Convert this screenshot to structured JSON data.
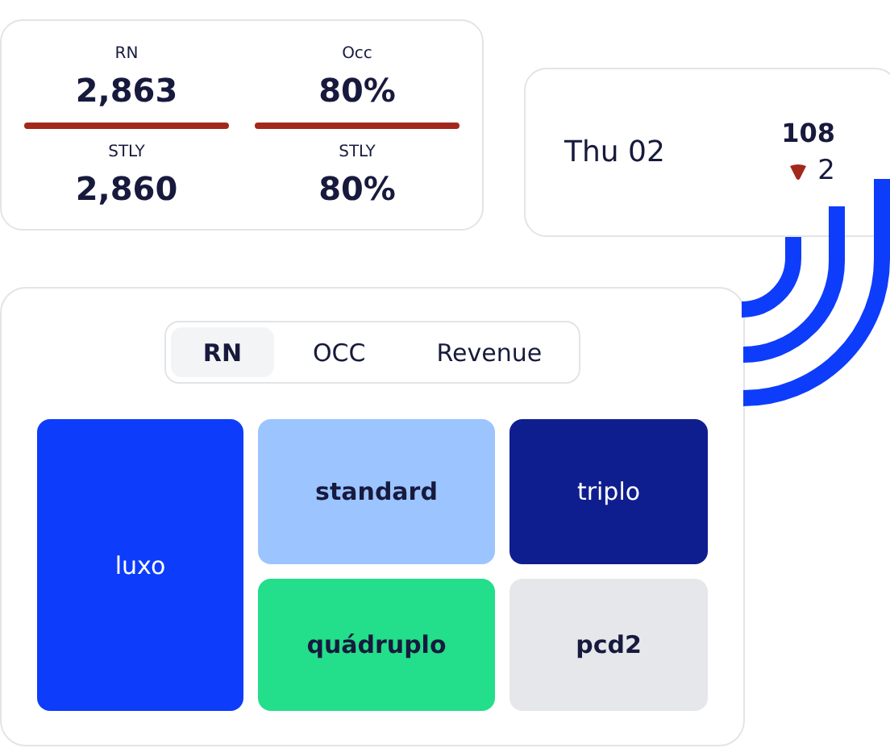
{
  "summary_card": {
    "metrics": [
      {
        "label": "RN",
        "value": "2,863",
        "color": "#a3281c",
        "stly_label": "STLY",
        "stly_value": "2,860"
      },
      {
        "label": "Occ",
        "value": "80%",
        "color": "#a3281c",
        "stly_label": "STLY",
        "stly_value": "80%"
      }
    ]
  },
  "day_card": {
    "date": "Thu 02",
    "value": "108",
    "down": true,
    "change": "2"
  },
  "treemap_card": {
    "tabs": [
      {
        "label": "RN",
        "selected": true
      },
      {
        "label": "OCC",
        "selected": false
      },
      {
        "label": "Revenue",
        "selected": false
      }
    ],
    "tile_columns": [
      [
        {
          "label": "luxo",
          "color": "#0d3dfa"
        }
      ],
      [
        {
          "label": "standard",
          "color": "#9cc4ff"
        },
        {
          "label": "quádruplo",
          "color": "#23de8a"
        }
      ],
      [
        {
          "label": "triplo",
          "color": "#0f1e8f"
        },
        {
          "label": "pcd2",
          "color": "#e6e7ea"
        }
      ]
    ]
  }
}
